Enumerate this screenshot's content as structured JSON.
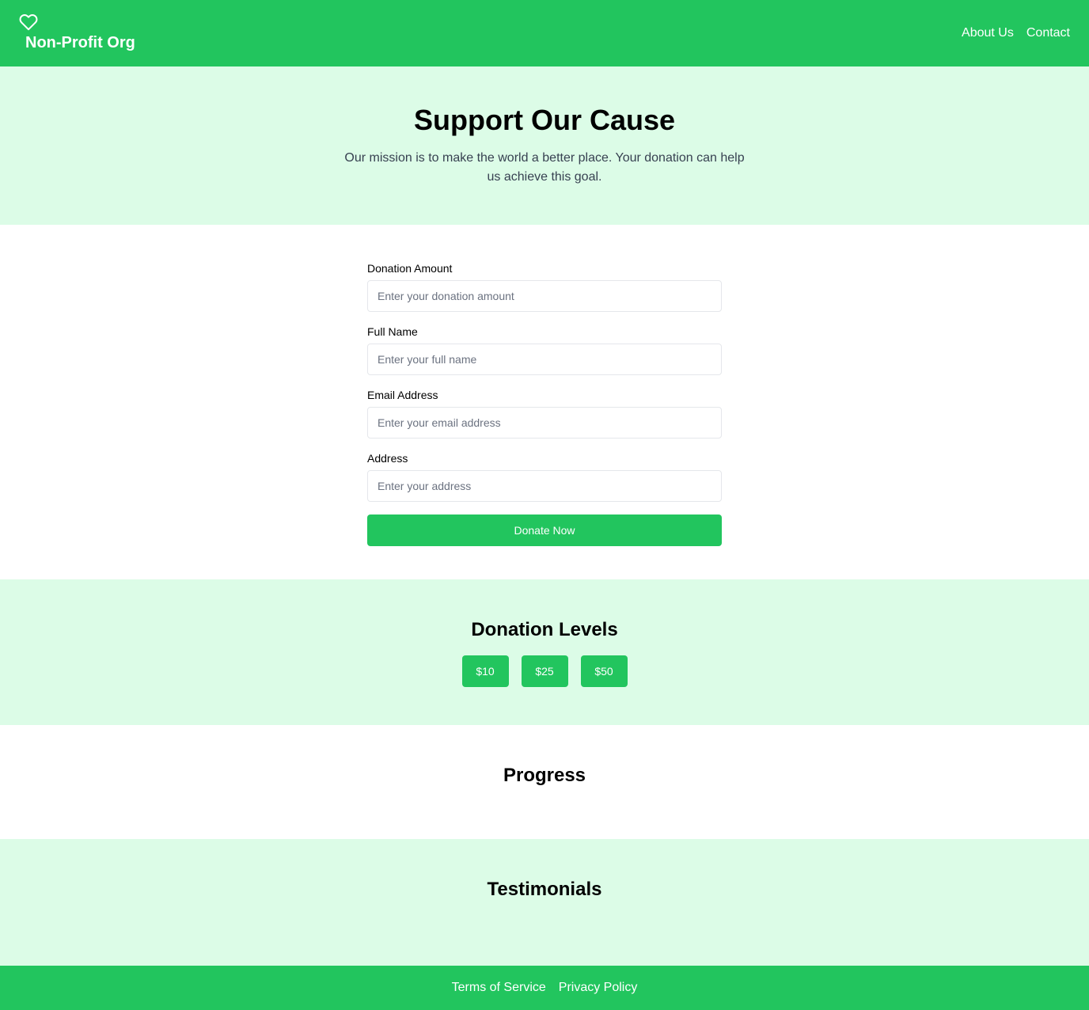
{
  "brand": {
    "name": "Non-Profit Org",
    "logo_icon": "heart-icon",
    "primary_color": "#22c55e",
    "light_bg_color": "#dcfce7"
  },
  "nav": {
    "items": [
      {
        "label": "About Us"
      },
      {
        "label": "Contact"
      }
    ]
  },
  "hero": {
    "title": "Support Our Cause",
    "description": "Our mission is to make the world a better place. Your donation can help us achieve this goal."
  },
  "form": {
    "fields": [
      {
        "label": "Donation Amount",
        "placeholder": "Enter your donation amount",
        "value": ""
      },
      {
        "label": "Full Name",
        "placeholder": "Enter your full name",
        "value": ""
      },
      {
        "label": "Email Address",
        "placeholder": "Enter your email address",
        "value": ""
      },
      {
        "label": "Address",
        "placeholder": "Enter your address",
        "value": ""
      }
    ],
    "submit_label": "Donate Now"
  },
  "levels": {
    "title": "Donation Levels",
    "options": [
      {
        "label": "$10"
      },
      {
        "label": "$25"
      },
      {
        "label": "$50"
      }
    ]
  },
  "progress": {
    "title": "Progress"
  },
  "testimonials": {
    "title": "Testimonials"
  },
  "footer": {
    "links": [
      {
        "label": "Terms of Service"
      },
      {
        "label": "Privacy Policy"
      }
    ]
  }
}
